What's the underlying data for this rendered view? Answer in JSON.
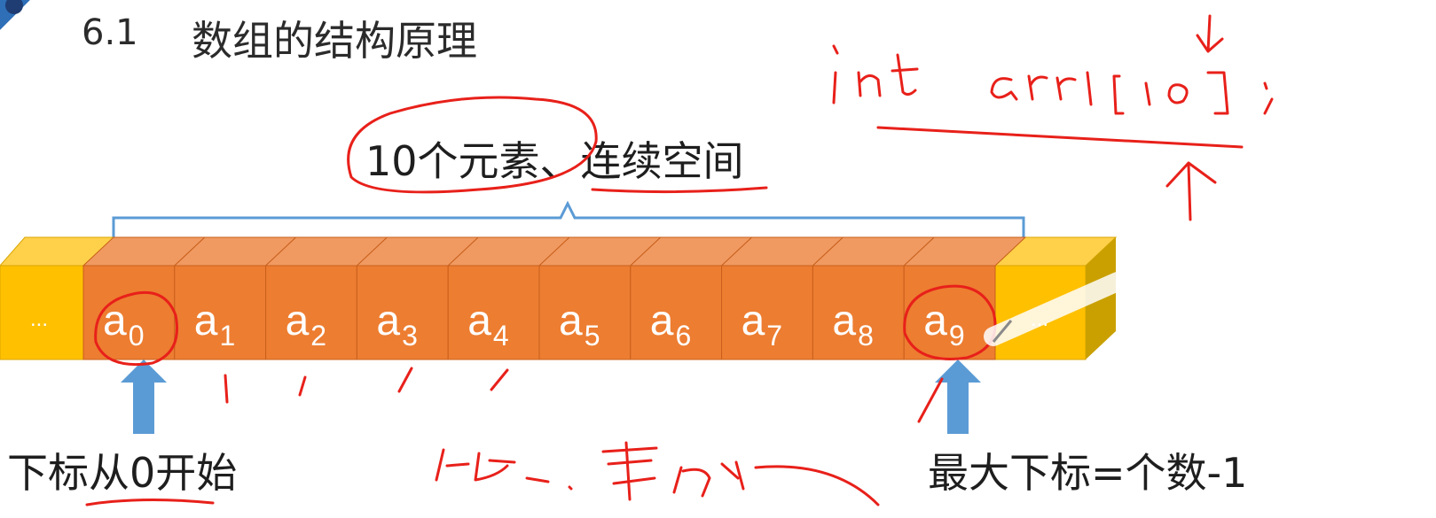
{
  "slide": {
    "section_number": "6.1",
    "section_title": "数组的结构原理",
    "brace_label": "10个元素、连续空间",
    "array": {
      "left_ellipsis": "...",
      "right_ellipsis": "...",
      "cells": [
        {
          "base": "a",
          "sub": "0"
        },
        {
          "base": "a",
          "sub": "1"
        },
        {
          "base": "a",
          "sub": "2"
        },
        {
          "base": "a",
          "sub": "3"
        },
        {
          "base": "a",
          "sub": "4"
        },
        {
          "base": "a",
          "sub": "5"
        },
        {
          "base": "a",
          "sub": "6"
        },
        {
          "base": "a",
          "sub": "7"
        },
        {
          "base": "a",
          "sub": "8"
        },
        {
          "base": "a",
          "sub": "9"
        }
      ]
    },
    "start_index_label": "下标从0开始",
    "max_index_label": "最大下标=个数-1"
  },
  "colors": {
    "cell_front": "#ED7D31",
    "cell_top": "#F09A62",
    "end_front": "#FFC000",
    "end_top": "#FFD04A",
    "end_side": "#C9A000",
    "brace": "#5B9BD5",
    "arrow": "#5B9BD5",
    "ink": "#E8201A"
  }
}
